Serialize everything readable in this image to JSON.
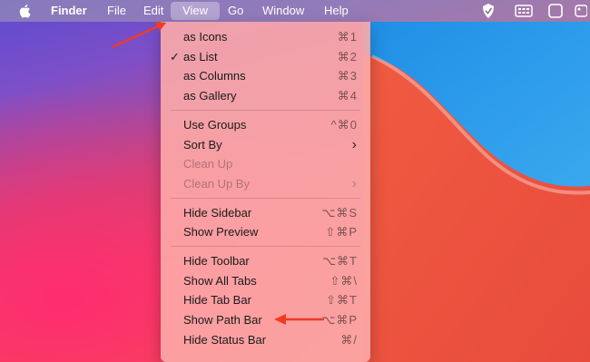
{
  "menubar": {
    "apple_icon": "apple-icon",
    "app_name": "Finder",
    "menus": [
      "File",
      "Edit",
      "View",
      "Go",
      "Window",
      "Help"
    ],
    "status_icons": [
      "shield-checkmark-icon",
      "keyboard-grid-icon",
      "window-icon",
      "control-center-icon"
    ]
  },
  "view_menu": {
    "groups": [
      [
        {
          "label": "as Icons",
          "shortcut": "⌘1",
          "checked": false,
          "enabled": true
        },
        {
          "label": "as List",
          "shortcut": "⌘2",
          "checked": true,
          "enabled": true
        },
        {
          "label": "as Columns",
          "shortcut": "⌘3",
          "checked": false,
          "enabled": true
        },
        {
          "label": "as Gallery",
          "shortcut": "⌘4",
          "checked": false,
          "enabled": true
        }
      ],
      [
        {
          "label": "Use Groups",
          "shortcut": "^⌘0",
          "checked": false,
          "enabled": true
        },
        {
          "label": "Sort By",
          "shortcut": "›",
          "checked": false,
          "enabled": true
        },
        {
          "label": "Clean Up",
          "shortcut": "",
          "checked": false,
          "enabled": false
        },
        {
          "label": "Clean Up By",
          "shortcut": "›",
          "checked": false,
          "enabled": false
        }
      ],
      [
        {
          "label": "Hide Sidebar",
          "shortcut": "⌥⌘S",
          "checked": false,
          "enabled": true
        },
        {
          "label": "Show Preview",
          "shortcut": "⇧⌘P",
          "checked": false,
          "enabled": true
        }
      ],
      [
        {
          "label": "Hide Toolbar",
          "shortcut": "⌥⌘T",
          "checked": false,
          "enabled": true
        },
        {
          "label": "Show All Tabs",
          "shortcut": "⇧⌘\\",
          "checked": false,
          "enabled": true
        },
        {
          "label": "Hide Tab Bar",
          "shortcut": "⇧⌘T",
          "checked": false,
          "enabled": true
        },
        {
          "label": "Show Path Bar",
          "shortcut": "⌥⌘P",
          "checked": false,
          "enabled": true
        },
        {
          "label": "Hide Status Bar",
          "shortcut": "⌘/",
          "checked": false,
          "enabled": true
        }
      ]
    ]
  },
  "annotations": {
    "arrow_color": "#f03b22"
  },
  "colors": {
    "menubar_text": "#ffffff",
    "menu_text": "#1b1b1b"
  }
}
